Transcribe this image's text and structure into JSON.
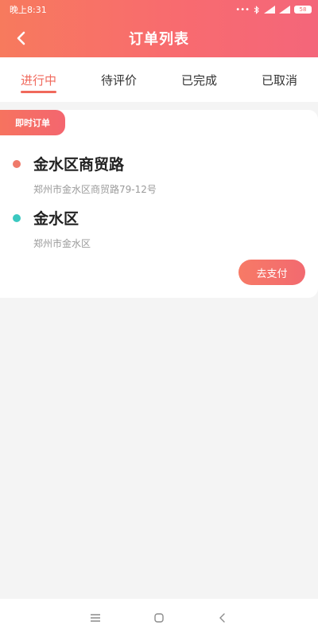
{
  "status_bar": {
    "time": "晚上8:31",
    "icons": [
      "dots-icon",
      "bluetooth-icon",
      "signal-icon",
      "signal-icon",
      "battery-icon"
    ],
    "battery": "58"
  },
  "header": {
    "title": "订单列表",
    "back_icon": "chevron-left-icon"
  },
  "tabs": [
    {
      "label": "进行中",
      "active": true
    },
    {
      "label": "待评价",
      "active": false
    },
    {
      "label": "已完成",
      "active": false
    },
    {
      "label": "已取消",
      "active": false
    }
  ],
  "order": {
    "tag": "即时订单",
    "start": {
      "name": "金水区商贸路",
      "detail": "郑州市金水区商贸路79-12号"
    },
    "end": {
      "name": "金水区",
      "detail": "郑州市金水区"
    },
    "pay_label": "去支付"
  },
  "colors": {
    "accent": "#f0695c",
    "header_start": "#f77a5d",
    "header_end": "#f4667a",
    "start_dot": "#ef7a6a",
    "end_dot": "#3bc8c0"
  },
  "system_nav": {
    "menu_icon": "menu-icon",
    "home_icon": "home-icon",
    "back_icon": "back-icon"
  }
}
